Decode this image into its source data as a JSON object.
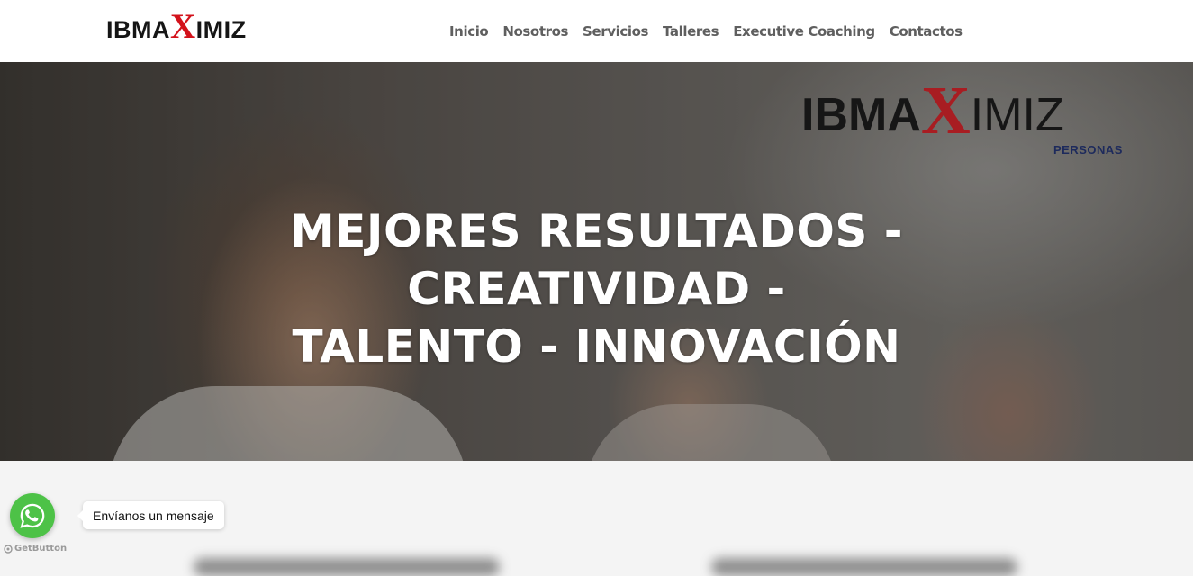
{
  "header": {
    "logo": {
      "pre": "IBMA",
      "x": "X",
      "post": "IMIZ"
    },
    "nav": [
      "Inicio",
      "Nosotros",
      "Servicios",
      "Talleres",
      "Executive Coaching",
      "Contactos"
    ]
  },
  "hero": {
    "logo": {
      "pre": "IBMA",
      "x": "X",
      "post": "IMIZ",
      "tagline": "PERSONAS"
    },
    "title_line1": "MEJORES RESULTADOS - CREATIVIDAD -",
    "title_line2": "TALENTO - INNOVACIÓN"
  },
  "whatsapp": {
    "bubble_text": "Envíanos un mensaje",
    "credit": "GetButton",
    "color": "#4dc247"
  },
  "colors": {
    "logo_x": "#d3121b",
    "nav_text": "#5f5f5f",
    "hero_tagline": "#1d2a5c"
  }
}
